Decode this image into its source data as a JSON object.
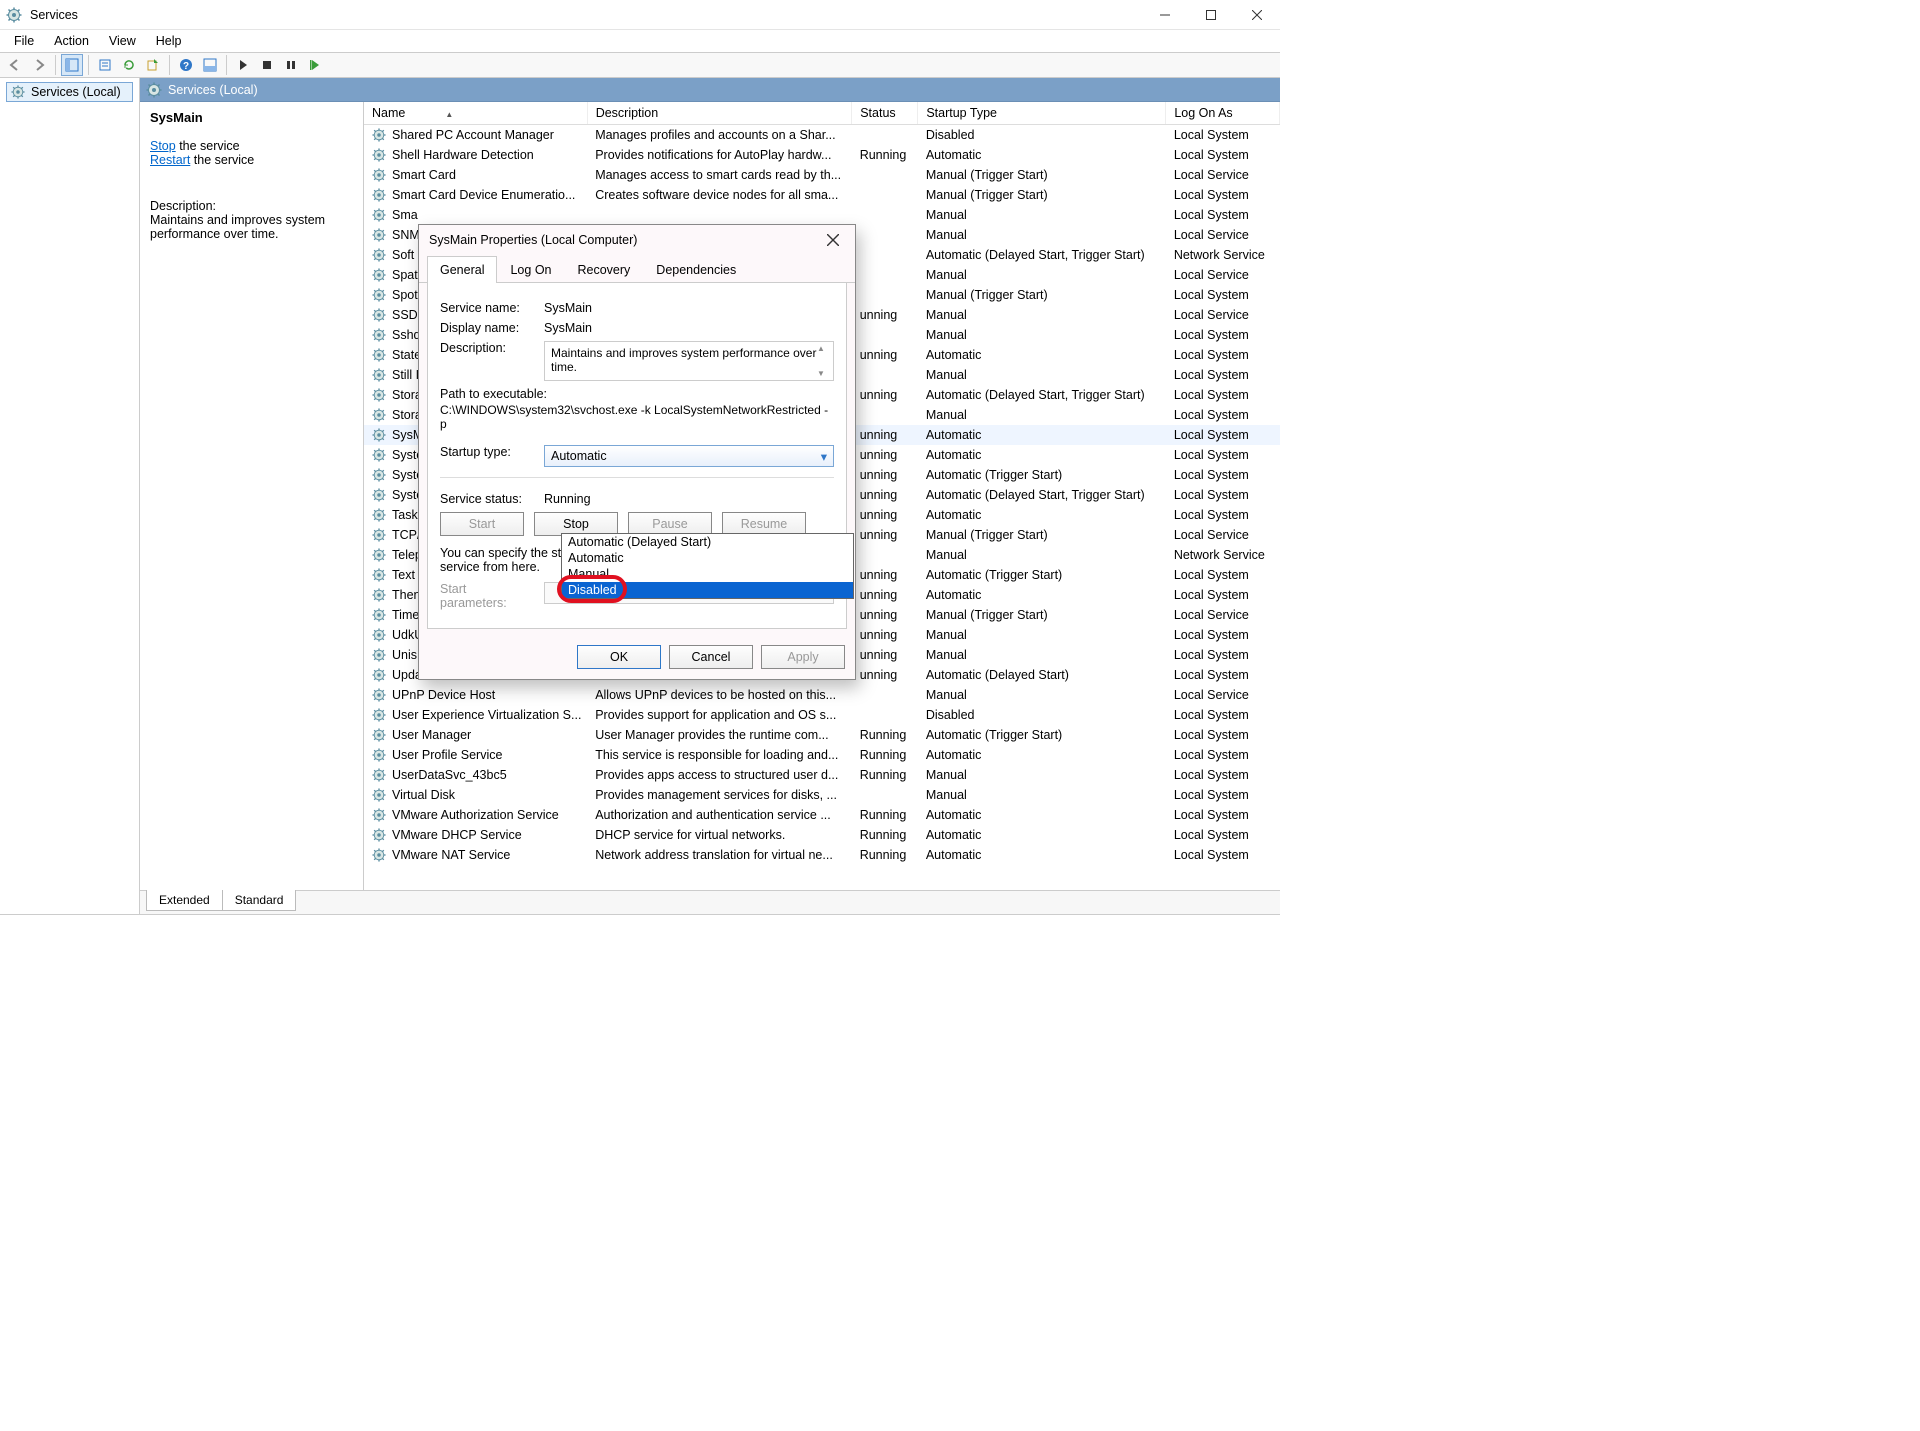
{
  "window": {
    "title": "Services"
  },
  "menu": {
    "file": "File",
    "action": "Action",
    "view": "View",
    "help": "Help"
  },
  "tree": {
    "root": "Services (Local)"
  },
  "banner": {
    "title": "Services (Local)"
  },
  "info": {
    "selected_name": "SysMain",
    "link_stop": "Stop",
    "link_stop_suffix": " the service",
    "link_restart": "Restart",
    "link_restart_suffix": " the service",
    "desc_label": "Description:",
    "desc_text": "Maintains and improves system performance over time."
  },
  "columns": {
    "name": "Name",
    "description": "Description",
    "status": "Status",
    "startup": "Startup Type",
    "logon": "Log On As"
  },
  "rows": [
    {
      "name": "Shared PC Account Manager",
      "desc": "Manages profiles and accounts on a Shar...",
      "status": "",
      "startup": "Disabled",
      "logon": "Local System"
    },
    {
      "name": "Shell Hardware Detection",
      "desc": "Provides notifications for AutoPlay hardw...",
      "status": "Running",
      "startup": "Automatic",
      "logon": "Local System"
    },
    {
      "name": "Smart Card",
      "desc": "Manages access to smart cards read by th...",
      "status": "",
      "startup": "Manual (Trigger Start)",
      "logon": "Local Service"
    },
    {
      "name": "Smart Card Device Enumeratio...",
      "desc": "Creates software device nodes for all sma...",
      "status": "",
      "startup": "Manual (Trigger Start)",
      "logon": "Local System"
    },
    {
      "name": "Sma",
      "desc": "",
      "status": "",
      "startup": "Manual",
      "logon": "Local System"
    },
    {
      "name": "SNM",
      "desc": "",
      "status": "",
      "startup": "Manual",
      "logon": "Local Service"
    },
    {
      "name": "Soft",
      "desc": "",
      "status": "",
      "startup": "Automatic (Delayed Start, Trigger Start)",
      "logon": "Network Service"
    },
    {
      "name": "Spat",
      "desc": "",
      "status": "",
      "startup": "Manual",
      "logon": "Local Service"
    },
    {
      "name": "Spot",
      "desc": "",
      "status": "",
      "startup": "Manual (Trigger Start)",
      "logon": "Local System"
    },
    {
      "name": "SSDP",
      "desc": "",
      "status": "unning",
      "startup": "Manual",
      "logon": "Local Service"
    },
    {
      "name": "Sshd",
      "desc": "",
      "status": "",
      "startup": "Manual",
      "logon": "Local System"
    },
    {
      "name": "State",
      "desc": "",
      "status": "unning",
      "startup": "Automatic",
      "logon": "Local System"
    },
    {
      "name": "Still I",
      "desc": "",
      "status": "",
      "startup": "Manual",
      "logon": "Local System"
    },
    {
      "name": "Stora",
      "desc": "",
      "status": "unning",
      "startup": "Automatic (Delayed Start, Trigger Start)",
      "logon": "Local System"
    },
    {
      "name": "Stora",
      "desc": "",
      "status": "",
      "startup": "Manual",
      "logon": "Local System"
    },
    {
      "name": "SysM",
      "desc": "",
      "status": "unning",
      "startup": "Automatic",
      "logon": "Local System",
      "selected": true
    },
    {
      "name": "Syste",
      "desc": "",
      "status": "unning",
      "startup": "Automatic",
      "logon": "Local System"
    },
    {
      "name": "Syste",
      "desc": "",
      "status": "unning",
      "startup": "Automatic (Trigger Start)",
      "logon": "Local System"
    },
    {
      "name": "Syste",
      "desc": "",
      "status": "unning",
      "startup": "Automatic (Delayed Start, Trigger Start)",
      "logon": "Local System"
    },
    {
      "name": "Task",
      "desc": "",
      "status": "unning",
      "startup": "Automatic",
      "logon": "Local System"
    },
    {
      "name": "TCP/",
      "desc": "",
      "status": "unning",
      "startup": "Manual (Trigger Start)",
      "logon": "Local Service"
    },
    {
      "name": "Telep",
      "desc": "",
      "status": "",
      "startup": "Manual",
      "logon": "Network Service"
    },
    {
      "name": "Text",
      "desc": "",
      "status": "unning",
      "startup": "Automatic (Trigger Start)",
      "logon": "Local System"
    },
    {
      "name": "Then",
      "desc": "",
      "status": "unning",
      "startup": "Automatic",
      "logon": "Local System"
    },
    {
      "name": "Time",
      "desc": "",
      "status": "unning",
      "startup": "Manual (Trigger Start)",
      "logon": "Local Service"
    },
    {
      "name": "UdkU",
      "desc": "",
      "status": "unning",
      "startup": "Manual",
      "logon": "Local System"
    },
    {
      "name": "Unis",
      "desc": "",
      "status": "unning",
      "startup": "Manual",
      "logon": "Local System"
    },
    {
      "name": "Upda",
      "desc": "",
      "status": "unning",
      "startup": "Automatic (Delayed Start)",
      "logon": "Local System"
    },
    {
      "name": "UPnP Device Host",
      "desc": "Allows UPnP devices to be hosted on this...",
      "status": "",
      "startup": "Manual",
      "logon": "Local Service"
    },
    {
      "name": "User Experience Virtualization S...",
      "desc": "Provides support for application and OS s...",
      "status": "",
      "startup": "Disabled",
      "logon": "Local System"
    },
    {
      "name": "User Manager",
      "desc": "User Manager provides the runtime com...",
      "status": "Running",
      "startup": "Automatic (Trigger Start)",
      "logon": "Local System"
    },
    {
      "name": "User Profile Service",
      "desc": "This service is responsible for loading and...",
      "status": "Running",
      "startup": "Automatic",
      "logon": "Local System"
    },
    {
      "name": "UserDataSvc_43bc5",
      "desc": "Provides apps access to structured user d...",
      "status": "Running",
      "startup": "Manual",
      "logon": "Local System"
    },
    {
      "name": "Virtual Disk",
      "desc": "Provides management services for disks, ...",
      "status": "",
      "startup": "Manual",
      "logon": "Local System"
    },
    {
      "name": "VMware Authorization Service",
      "desc": "Authorization and authentication service ...",
      "status": "Running",
      "startup": "Automatic",
      "logon": "Local System"
    },
    {
      "name": "VMware DHCP Service",
      "desc": "DHCP service for virtual networks.",
      "status": "Running",
      "startup": "Automatic",
      "logon": "Local System"
    },
    {
      "name": "VMware NAT Service",
      "desc": "Network address translation for virtual ne...",
      "status": "Running",
      "startup": "Automatic",
      "logon": "Local System"
    }
  ],
  "tabs": {
    "extended": "Extended",
    "standard": "Standard"
  },
  "dialog": {
    "title": "SysMain Properties (Local Computer)",
    "tabs": {
      "general": "General",
      "logon": "Log On",
      "recovery": "Recovery",
      "deps": "Dependencies"
    },
    "labels": {
      "service_name": "Service name:",
      "display_name": "Display name:",
      "description": "Description:",
      "path_label": "Path to executable:",
      "startup_type": "Startup type:",
      "service_status": "Service status:",
      "help": "You can specify the start parameters that apply when you start the service from here.",
      "start_params": "Start parameters:"
    },
    "values": {
      "service_name": "SysMain",
      "display_name": "SysMain",
      "description": "Maintains and improves system performance over time.",
      "path": "C:\\WINDOWS\\system32\\svchost.exe -k LocalSystemNetworkRestricted -p",
      "startup_selected": "Automatic",
      "status": "Running"
    },
    "dropdown_options": [
      "Automatic (Delayed Start)",
      "Automatic",
      "Manual",
      "Disabled"
    ],
    "dropdown_selected": "Disabled",
    "buttons": {
      "start": "Start",
      "stop": "Stop",
      "pause": "Pause",
      "resume": "Resume",
      "ok": "OK",
      "cancel": "Cancel",
      "apply": "Apply"
    }
  }
}
